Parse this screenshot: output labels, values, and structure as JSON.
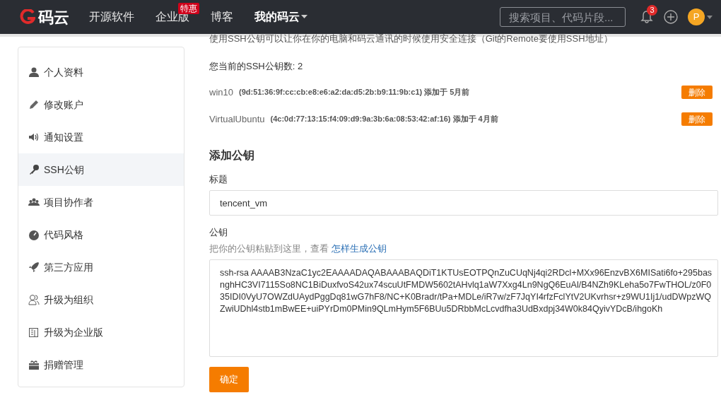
{
  "header": {
    "logo": "码云",
    "nav": [
      {
        "label": "开源软件",
        "selected": false
      },
      {
        "label": "企业版",
        "selected": false,
        "badge": "特惠"
      },
      {
        "label": "博客",
        "selected": false
      },
      {
        "label": "我的码云",
        "selected": true,
        "dropdown": true
      }
    ],
    "search": {
      "placeholder": "搜索项目、代码片段..."
    },
    "notifications": "3",
    "avatar": "P"
  },
  "sidebar": {
    "items": [
      {
        "label": "个人资料",
        "selected": false
      },
      {
        "label": "修改账户",
        "selected": false
      },
      {
        "label": "通知设置",
        "selected": false
      },
      {
        "label": "SSH公钥",
        "selected": true
      },
      {
        "label": "项目协作者",
        "selected": false
      },
      {
        "label": "代码风格",
        "selected": false
      },
      {
        "label": "第三方应用",
        "selected": false
      },
      {
        "label": "升级为组织",
        "selected": false
      },
      {
        "label": "升级为企业版",
        "selected": false
      },
      {
        "label": "捐赠管理",
        "selected": false
      }
    ]
  },
  "intro": "使用SSH公钥可以让你在你的电脑和码云通讯的时候使用安全连接（Git的Remote要使用SSH地址）",
  "key_count": "您当前的SSH公钥数: 2",
  "keys": [
    {
      "name": "win10",
      "fingerprint": "(9d:51:36:9f:cc:cb:e8:e6:a2:da:d5:2b:b9:11:9b:c1) 添加于 5月前",
      "delete": "删除"
    },
    {
      "name": "VirtualUbuntu",
      "fingerprint": "(4c:0d:77:13:15:f4:09:d9:9a:3b:6a:08:53:42:af:16) 添加于 4月前",
      "delete": "删除"
    }
  ],
  "add_key": {
    "heading": "添加公钥",
    "title_label": "标题",
    "title_value": "tencent_vm",
    "key_label": "公钥",
    "hint": "把你的公钥粘贴到这里，查看",
    "hint_link": "怎样生成公钥",
    "key_value": "ssh-rsa AAAAB3NzaC1yc2EAAAADAQABAAABAQDiT1KTUsEOTPQnZuCUqNj4qi2RDcl+MXx96EnzvBX6MISati6fo+295basnghHC3VI7115So8NC1BiDuxfvoS42ux74scuUtFMDW5602tAHvlq1aW7Xxg4Ln9NgQ6EuAl/B4NZh9KLeha5o7FwTHOL/z0F035IDI0VyU7OWZdUAydPggDq81wG7hF8/NC+K0Bradr/tPa+MDLe/iR7w/zF7JqYI4rfzFclYtV2UKvrhsr+z9WU1Ij1/udDWpzWQZwiUDhl4stb1mBwEE+uiPYrDm0PMin9QLmHym5F6BUu5DRbbMcLcvdfha3UdBxdpj34W0k84QyivYDcB/ihgoKh",
    "submit": "确定"
  }
}
